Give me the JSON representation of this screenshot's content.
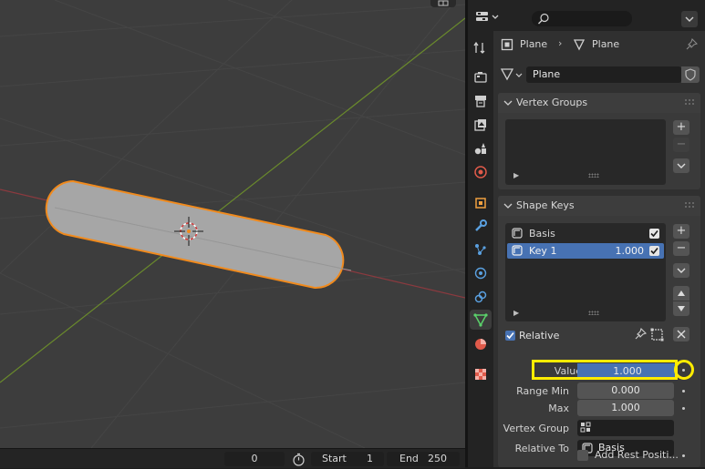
{
  "timeline": {
    "current_frame": "0",
    "start_label": "Start",
    "start_value": "1",
    "end_label": "End",
    "end_value": "250"
  },
  "properties": {
    "header": {
      "search_placeholder": ""
    },
    "breadcrumb": {
      "object_name": "Plane",
      "mesh_name": "Plane"
    },
    "datablock": {
      "name": "Plane"
    },
    "vertex_groups": {
      "title": "Vertex Groups"
    },
    "shape_keys": {
      "title": "Shape Keys",
      "items": [
        {
          "name": "Basis",
          "value": ""
        },
        {
          "name": "Key 1",
          "value": "1.000"
        }
      ],
      "relative_label": "Relative",
      "value_label": "Value",
      "value": "1.000",
      "range_min_label": "Range Min",
      "range_min": "0.000",
      "max_label": "Max",
      "max": "1.000",
      "vertex_group_label": "Vertex Group",
      "vertex_group_value": "",
      "relative_to_label": "Relative To",
      "relative_to_value": "Basis",
      "add_rest_label": "Add Rest Positi..."
    }
  },
  "colors": {
    "highlight": "#ffec00",
    "selection_orange": "#f08a1d",
    "active_blue": "#4772b3",
    "mesh_tab_green": "#5bd16b"
  }
}
